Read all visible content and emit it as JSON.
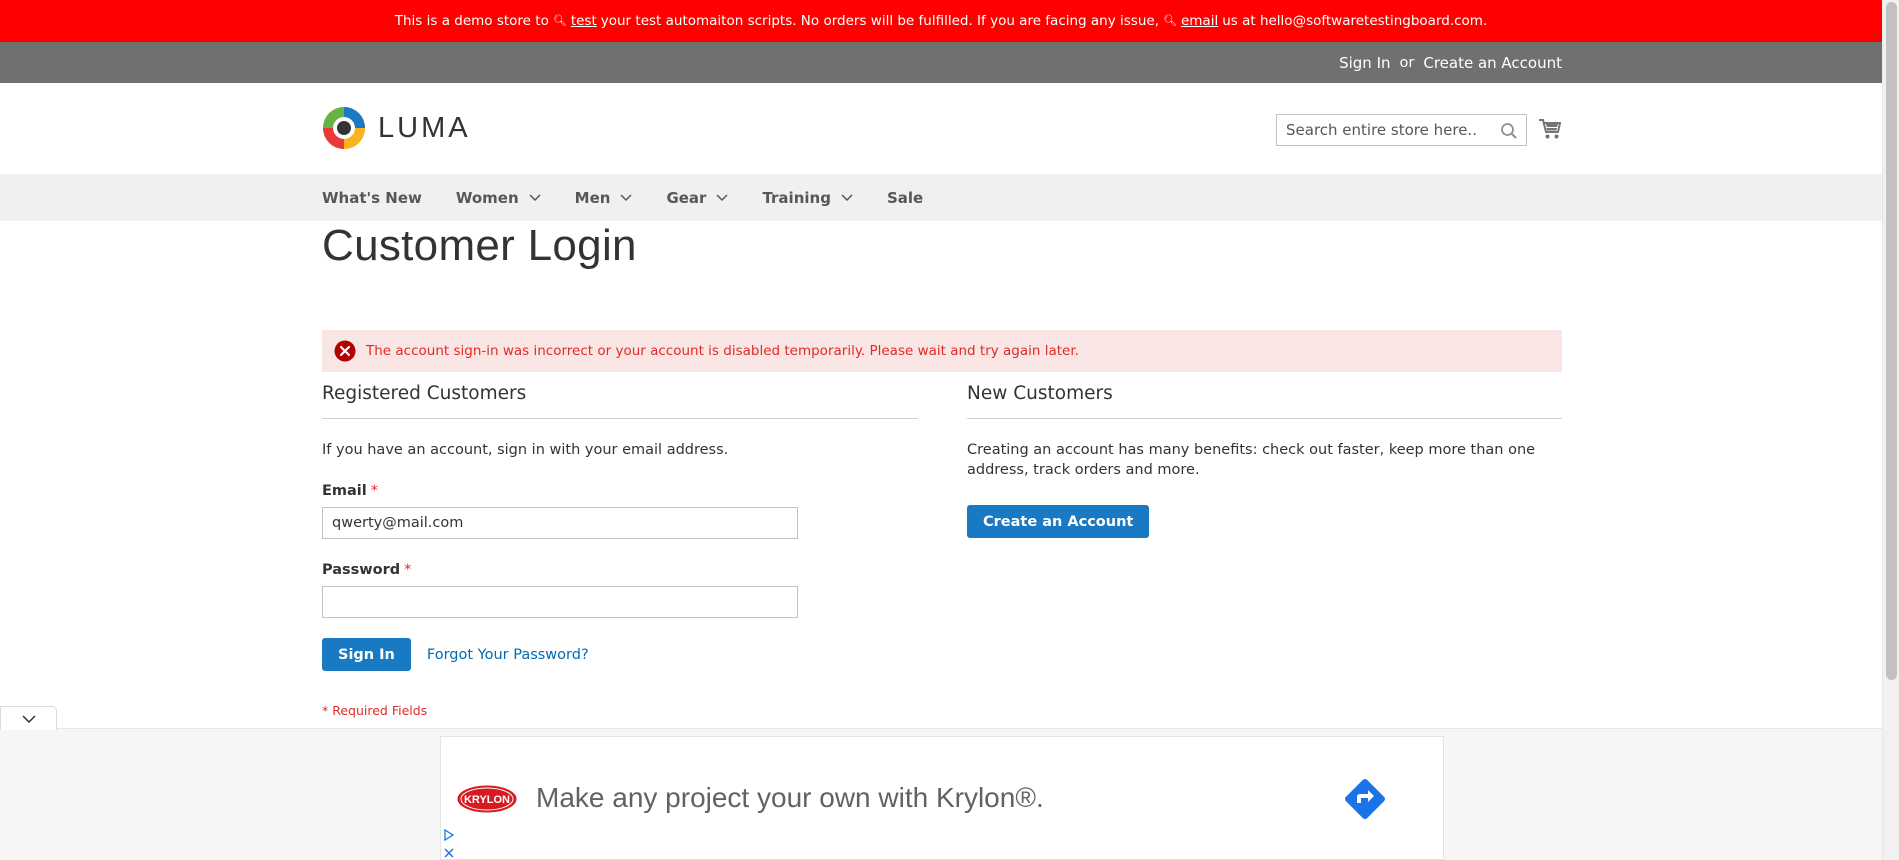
{
  "demo_banner": {
    "text_1": "This is a demo store to",
    "link_test": "test",
    "text_2": "your test automaiton scripts. No orders will be fulfilled. If you are facing any issue,",
    "link_email": "email",
    "text_3": "us at hello@softwaretestingboard.com.",
    "bg_color": "#ff0000"
  },
  "top_bar": {
    "sign_in": "Sign In",
    "or": "or",
    "create_account": "Create an Account"
  },
  "header": {
    "logo_text": "LUMA",
    "search_placeholder": "Search entire store here..."
  },
  "nav": {
    "items": [
      {
        "label": "What's New",
        "has_dropdown": false
      },
      {
        "label": "Women",
        "has_dropdown": true
      },
      {
        "label": "Men",
        "has_dropdown": true
      },
      {
        "label": "Gear",
        "has_dropdown": true
      },
      {
        "label": "Training",
        "has_dropdown": true
      },
      {
        "label": "Sale",
        "has_dropdown": false
      }
    ]
  },
  "main": {
    "page_title": "Customer Login",
    "error_message": "The account sign-in was incorrect or your account is disabled temporarily. Please wait and try again later.",
    "registered": {
      "title": "Registered Customers",
      "intro": "If you have an account, sign in with your email address.",
      "email_label": "Email",
      "email_value": "qwerty@mail.com",
      "password_label": "Password",
      "password_value": "",
      "required_mark": "*",
      "sign_in_button": "Sign In",
      "forgot_link": "Forgot Your Password?",
      "required_note": "* Required Fields"
    },
    "new_customers": {
      "title": "New Customers",
      "intro": "Creating an account has many benefits: check out faster, keep more than one address, track orders and more.",
      "create_button": "Create an Account"
    }
  },
  "ad": {
    "brand": "KRYLON",
    "text": "Make any project your own with Krylon®."
  },
  "colors": {
    "primary_button": "#1979c3",
    "link": "#006bb4",
    "error_text": "#e02b27",
    "error_bg": "#fae5e5",
    "top_bar": "#6e716e",
    "nav_bg": "#f0f0f0"
  },
  "icons": {
    "search": "search-icon",
    "cart": "cart-icon",
    "error": "error-icon",
    "chevron": "chevron-down-icon"
  }
}
